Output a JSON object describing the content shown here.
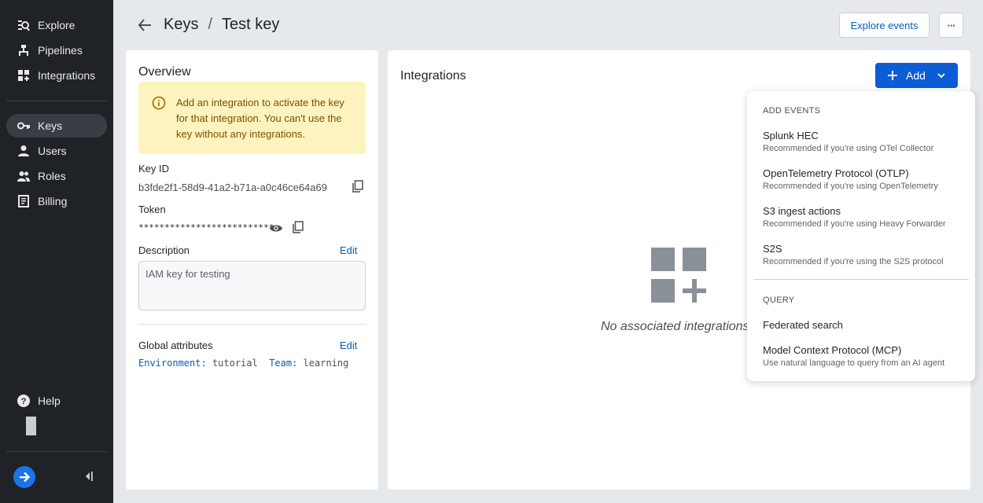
{
  "sidebar": {
    "items": [
      {
        "label": "Explore",
        "icon": "explore-search-icon"
      },
      {
        "label": "Pipelines",
        "icon": "pipelines-icon"
      },
      {
        "label": "Integrations",
        "icon": "integrations-grid-icon"
      },
      {
        "label": "Keys",
        "icon": "key-icon",
        "active": true
      },
      {
        "label": "Users",
        "icon": "user-icon"
      },
      {
        "label": "Roles",
        "icon": "roles-icon"
      },
      {
        "label": "Billing",
        "icon": "billing-icon"
      }
    ],
    "help_label": "Help"
  },
  "header": {
    "crumb_parent": "Keys",
    "crumb_separator": "/",
    "crumb_current": "Test key",
    "explore_events_label": "Explore events",
    "more_label": "···"
  },
  "overview": {
    "title": "Overview",
    "warning": "Add an integration to activate the key for that integration. You can't use the key without any integrations.",
    "key_id_label": "Key ID",
    "key_id_value": "b3fde2f1-58d9-41a2-b71a-a0c46ce64a69",
    "token_label": "Token",
    "token_value": "**************************",
    "description_label": "Description",
    "description_edit": "Edit",
    "description_value": "IAM key for testing",
    "global_attributes_label": "Global attributes",
    "global_attributes_edit": "Edit",
    "attributes": [
      {
        "key": "Environment:",
        "value": "tutorial"
      },
      {
        "key": "Team:",
        "value": "learning"
      }
    ]
  },
  "integrations": {
    "title": "Integrations",
    "add_label": "Add",
    "empty_text": "No associated integrations"
  },
  "add_menu": {
    "add_events_header": "ADD EVENTS",
    "events": [
      {
        "title": "Splunk HEC",
        "subtitle": "Recommended if you're using OTel Collector"
      },
      {
        "title": "OpenTelemetry Protocol (OTLP)",
        "subtitle": "Recommended if you're using OpenTelemetry"
      },
      {
        "title": "S3 ingest actions",
        "subtitle": "Recommended if you're using Heavy Forwarder"
      },
      {
        "title": "S2S",
        "subtitle": "Recommended if you're using the S2S protocol"
      }
    ],
    "query_header": "QUERY",
    "query": [
      {
        "title": "Federated search",
        "subtitle": ""
      },
      {
        "title": "Model Context Protocol (MCP)",
        "subtitle": "Use natural language to query from an AI agent"
      }
    ]
  },
  "colors": {
    "sidebar_bg": "#1f2226",
    "accent": "#0b5cd5",
    "warning_bg": "#fdf3bf"
  }
}
